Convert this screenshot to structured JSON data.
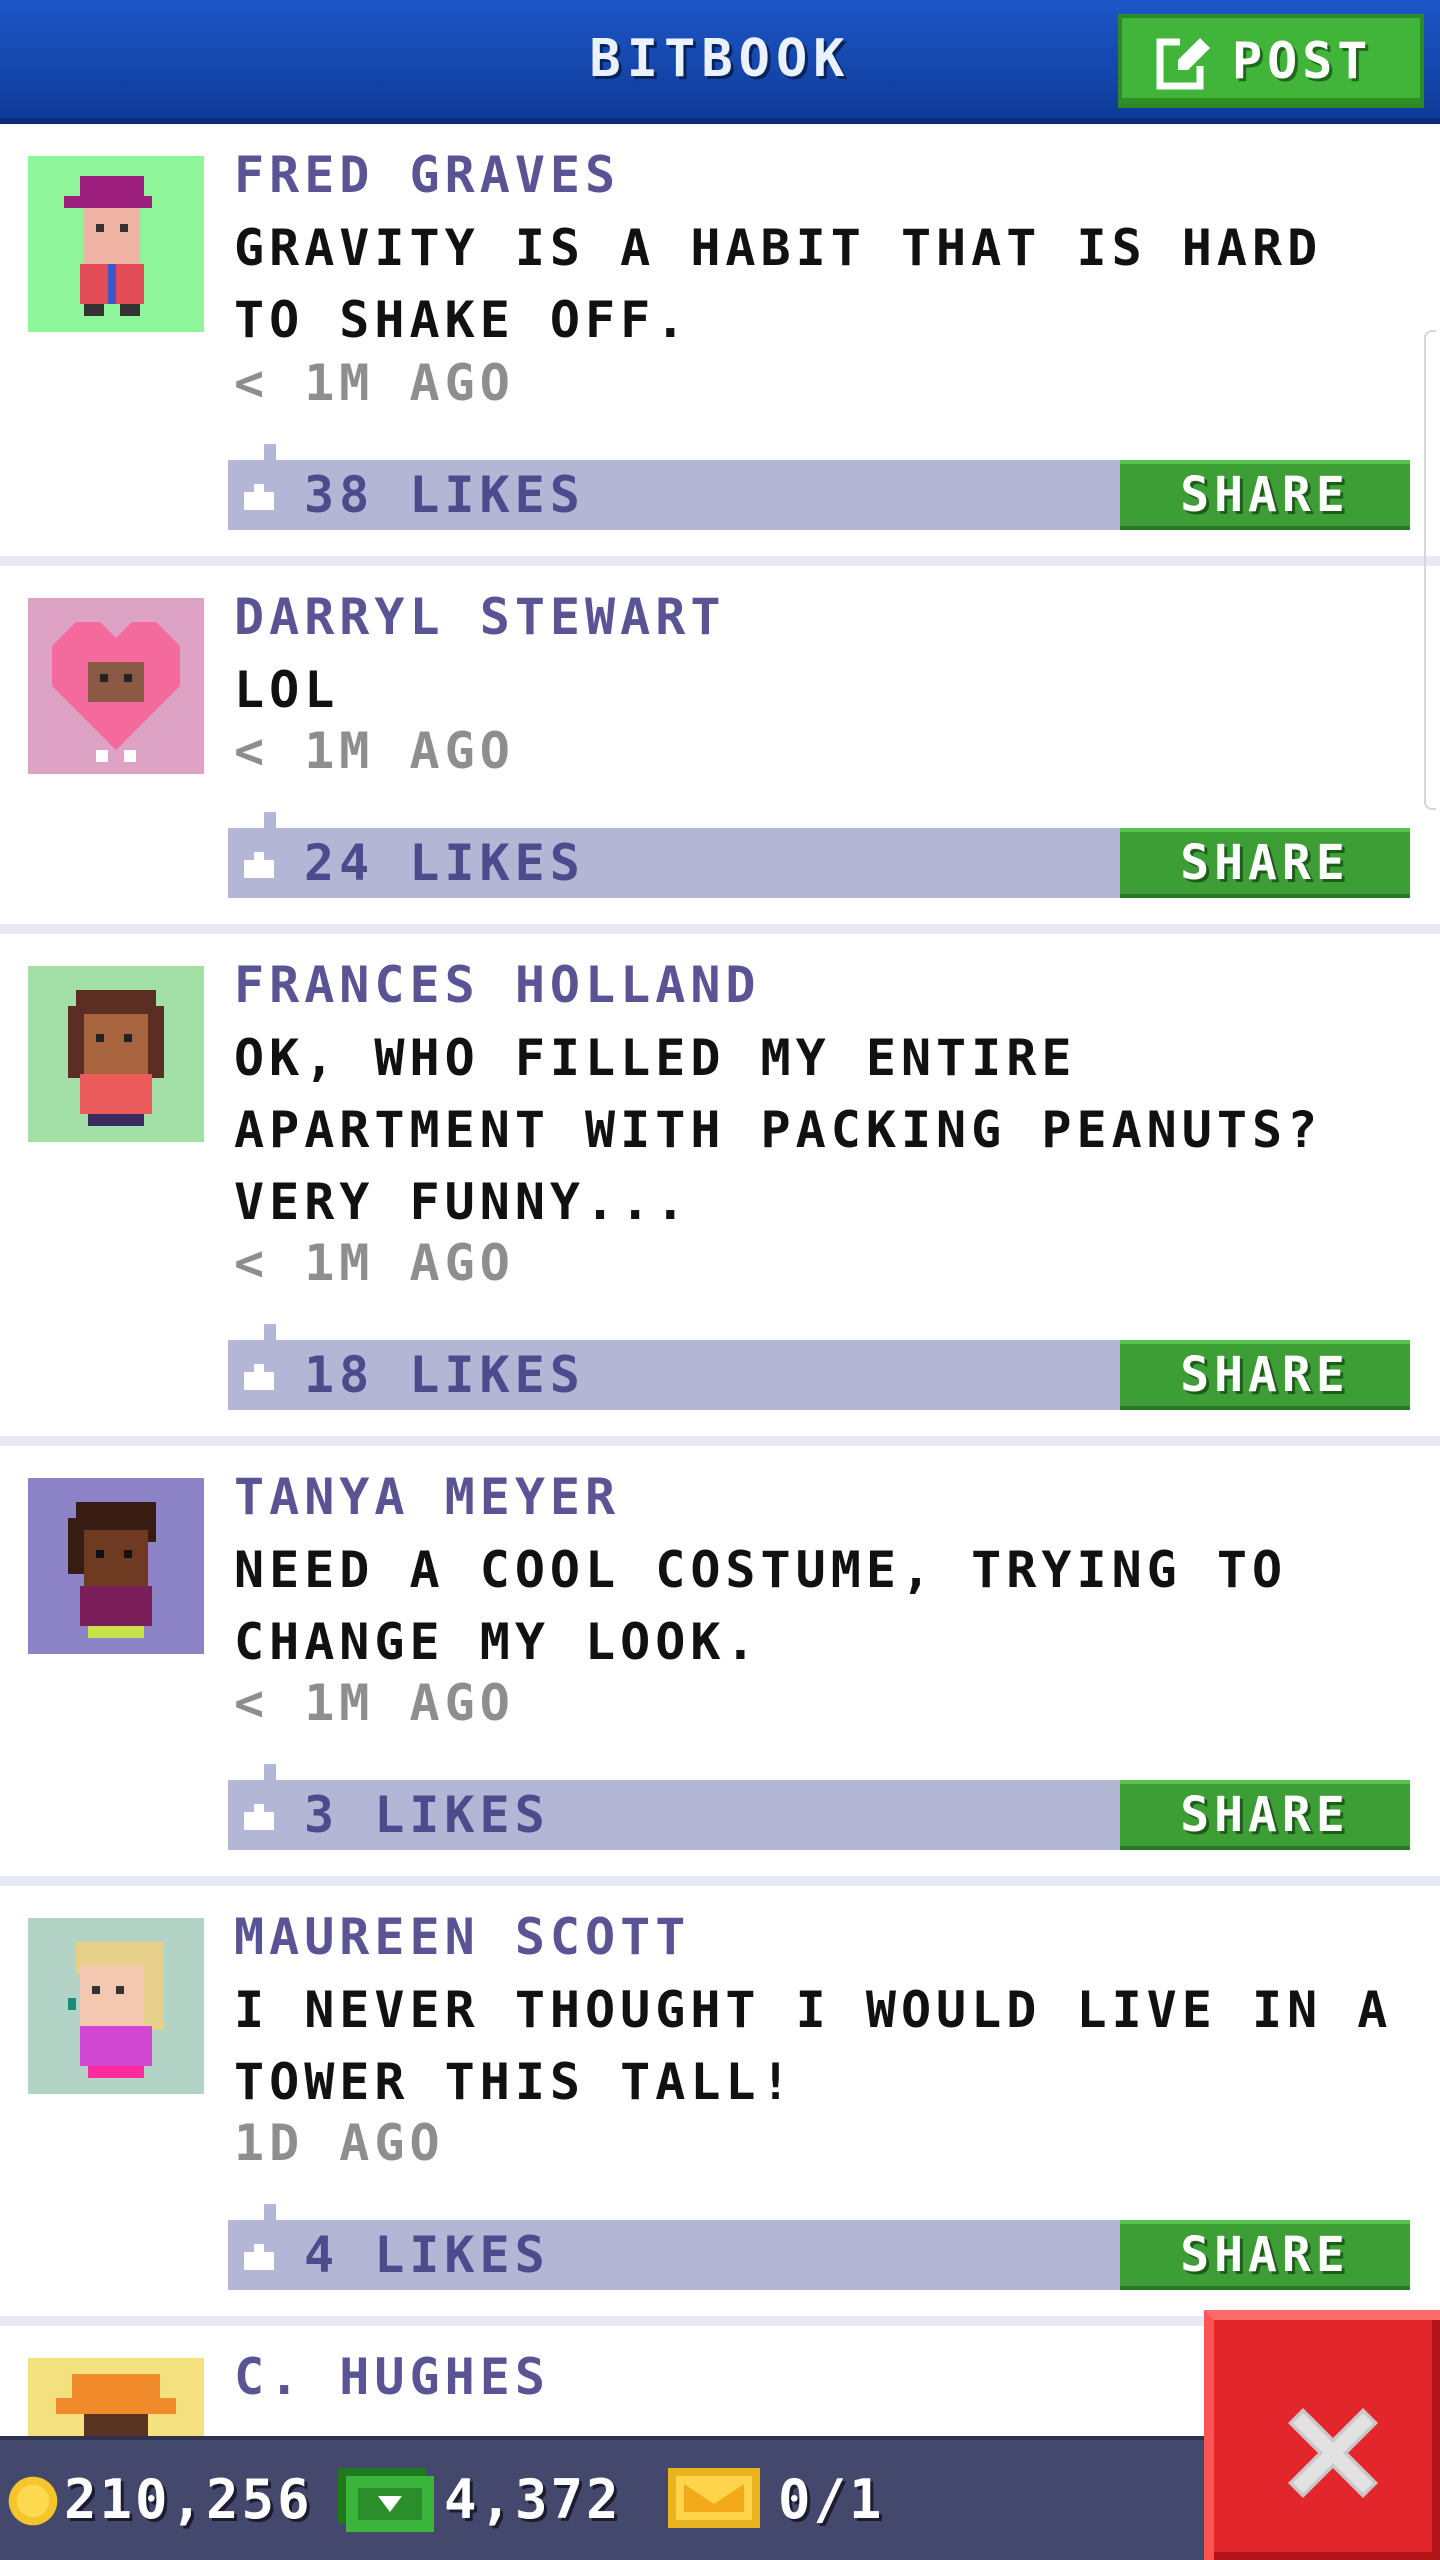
{
  "header": {
    "title": "BITBOOK",
    "post_label": "POST"
  },
  "posts": [
    {
      "author": "FRED GRAVES",
      "message": "GRAVITY IS A HABIT THAT IS HARD TO SHAKE OFF.",
      "time": "< 1M AGO",
      "likes": "38 LIKES",
      "share_label": "SHARE",
      "avatar_bg": "#8ef59a"
    },
    {
      "author": "DARRYL STEWART",
      "message": "LOL",
      "time": "< 1M AGO",
      "likes": "24 LIKES",
      "share_label": "SHARE",
      "avatar_bg": "#dda2c4"
    },
    {
      "author": "FRANCES HOLLAND",
      "message": "OK, WHO FILLED MY ENTIRE APARTMENT WITH PACKING PEANUTS? VERY FUNNY...",
      "time": "< 1M AGO",
      "likes": "18 LIKES",
      "share_label": "SHARE",
      "avatar_bg": "#a2e0a8"
    },
    {
      "author": "TANYA MEYER",
      "message": "NEED A COOL COSTUME, TRYING TO CHANGE MY LOOK.",
      "time": "< 1M AGO",
      "likes": "3 LIKES",
      "share_label": "SHARE",
      "avatar_bg": "#8c84c6"
    },
    {
      "author": "MAUREEN SCOTT",
      "message": "I NEVER THOUGHT I WOULD LIVE IN A TOWER THIS TALL!",
      "time": "1D AGO",
      "likes": "4 LIKES",
      "share_label": "SHARE",
      "avatar_bg": "#b2d3c5"
    },
    {
      "author": "C. HUGHES",
      "avatar_bg": "#f3e07e"
    }
  ],
  "bottom_bar": {
    "coins": "210,256",
    "bux": "4,372",
    "tickets": "0/1"
  },
  "colors": {
    "header_blue": "#1d56c7",
    "share_green": "#3c9e35",
    "likebar": "#b4b6d6",
    "author_purple": "#5b5494",
    "close_red": "#e3262b"
  },
  "icons": {
    "post": "edit-icon",
    "like": "thumbs-up-icon",
    "coin": "coin-icon",
    "bux": "bux-icon",
    "ticket": "ticket-icon",
    "close": "close-icon"
  }
}
